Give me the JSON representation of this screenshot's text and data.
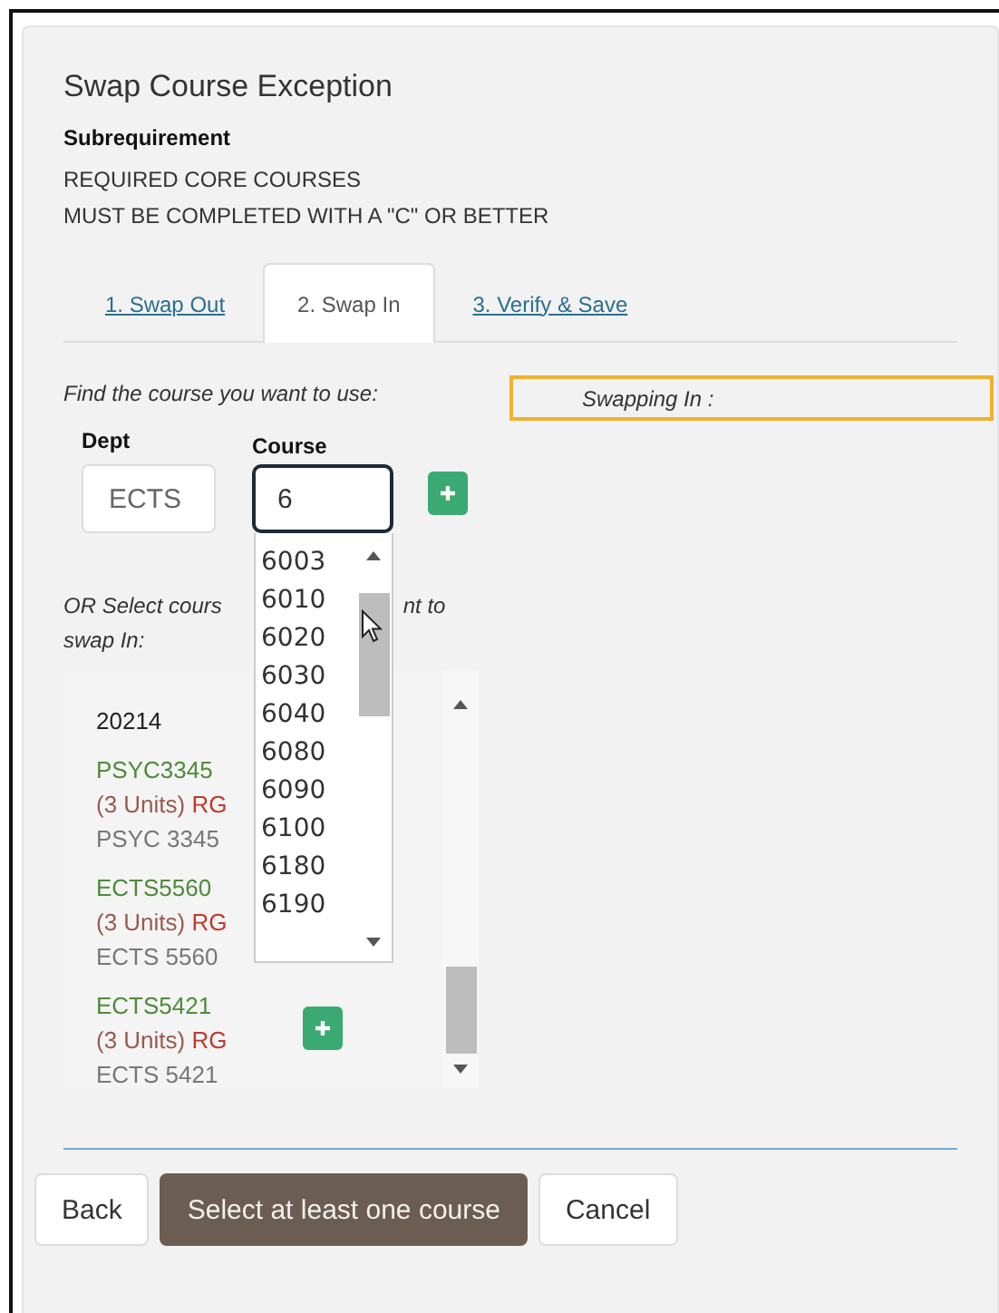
{
  "dialog": {
    "title": "Swap Course Exception",
    "subrequirement_label": "Subrequirement",
    "requirement_lines": [
      "REQUIRED CORE COURSES",
      "MUST BE COMPLETED WITH A \"C\" OR BETTER"
    ]
  },
  "tabs": [
    {
      "label": "1. Swap Out",
      "selected": false
    },
    {
      "label": "2. Swap In",
      "selected": true
    },
    {
      "label": "3. Verify & Save",
      "selected": false
    }
  ],
  "find_prompt": "Find the course you want to use:",
  "swapping_in_label": "Swapping In :",
  "dept": {
    "label": "Dept",
    "value": "ECTS"
  },
  "course": {
    "label": "Course",
    "value": "6"
  },
  "course_dropdown": {
    "options": [
      "6003",
      "6010",
      "6020",
      "6030",
      "6040",
      "6080",
      "6090",
      "6100",
      "6180",
      "6190"
    ]
  },
  "or_select_parts": [
    "OR Select cours",
    "nt to",
    "swap In:"
  ],
  "course_list": {
    "heading": "20214",
    "courses": [
      {
        "code": "PSYC3345",
        "units": "(3 Units)",
        "grade": "RG",
        "name": "PSYC 3345",
        "add_button": false
      },
      {
        "code": "ECTS5560",
        "units": "(3 Units)",
        "grade": "RG",
        "name": "ECTS 5560",
        "add_button": false
      },
      {
        "code": "ECTS5421",
        "units": "(3 Units)",
        "grade": "RG",
        "name": "ECTS 5421",
        "add_button": true
      }
    ]
  },
  "buttons": [
    {
      "label": "Back",
      "kind": "default"
    },
    {
      "label": "Select at least one course",
      "kind": "primary"
    },
    {
      "label": "Cancel",
      "kind": "default"
    }
  ]
}
